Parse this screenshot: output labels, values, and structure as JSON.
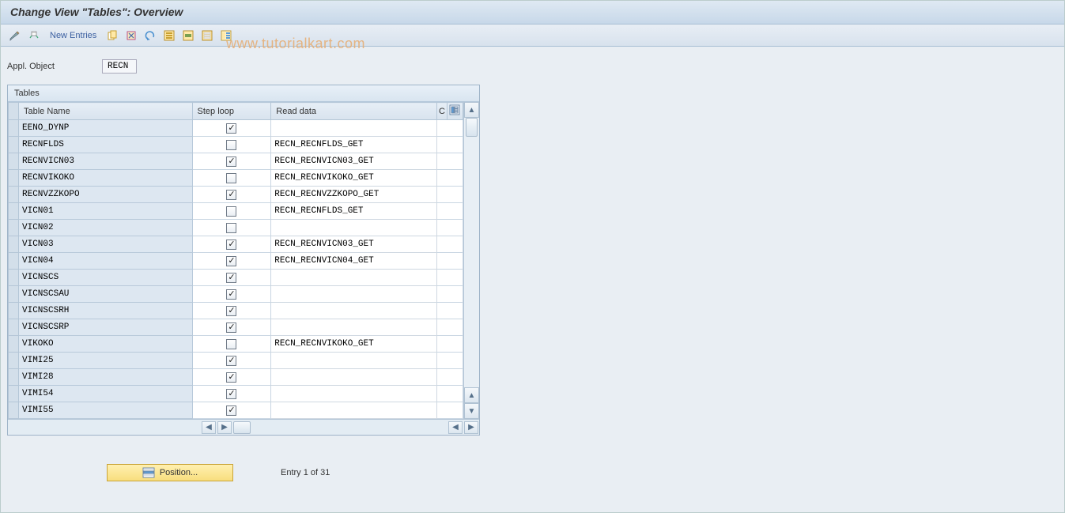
{
  "title": "Change View \"Tables\": Overview",
  "toolbar": {
    "new_entries_label": "New Entries"
  },
  "watermark": "www.tutorialkart.com",
  "field": {
    "label": "Appl. Object",
    "value": "RECN"
  },
  "panel": {
    "title": "Tables",
    "columns": {
      "table_name": "Table Name",
      "step_loop": "Step loop",
      "read_data": "Read data",
      "c": "C"
    },
    "rows": [
      {
        "name": "EENO_DYNP",
        "step": true,
        "read": ""
      },
      {
        "name": "RECNFLDS",
        "step": false,
        "read": "RECN_RECNFLDS_GET"
      },
      {
        "name": "RECNVICN03",
        "step": true,
        "read": "RECN_RECNVICN03_GET"
      },
      {
        "name": "RECNVIKOKO",
        "step": false,
        "read": "RECN_RECNVIKOKO_GET"
      },
      {
        "name": "RECNVZZKOPO",
        "step": true,
        "read": "RECN_RECNVZZKOPO_GET"
      },
      {
        "name": "VICN01",
        "step": false,
        "read": "RECN_RECNFLDS_GET"
      },
      {
        "name": "VICN02",
        "step": false,
        "read": ""
      },
      {
        "name": "VICN03",
        "step": true,
        "read": "RECN_RECNVICN03_GET"
      },
      {
        "name": "VICN04",
        "step": true,
        "read": "RECN_RECNVICN04_GET"
      },
      {
        "name": "VICNSCS",
        "step": true,
        "read": ""
      },
      {
        "name": "VICNSCSAU",
        "step": true,
        "read": ""
      },
      {
        "name": "VICNSCSRH",
        "step": true,
        "read": ""
      },
      {
        "name": "VICNSCSRP",
        "step": true,
        "read": ""
      },
      {
        "name": "VIKOKO",
        "step": false,
        "read": "RECN_RECNVIKOKO_GET"
      },
      {
        "name": "VIMI25",
        "step": true,
        "read": ""
      },
      {
        "name": "VIMI28",
        "step": true,
        "read": ""
      },
      {
        "name": "VIMI54",
        "step": true,
        "read": ""
      },
      {
        "name": "VIMI55",
        "step": true,
        "read": ""
      }
    ]
  },
  "footer": {
    "position_label": "Position...",
    "entry_text": "Entry 1 of 31"
  },
  "colors": {
    "accent_blue": "#5b9bd5",
    "panel_border": "#9fb4c8",
    "yellow_btn": "#f8de7e"
  }
}
